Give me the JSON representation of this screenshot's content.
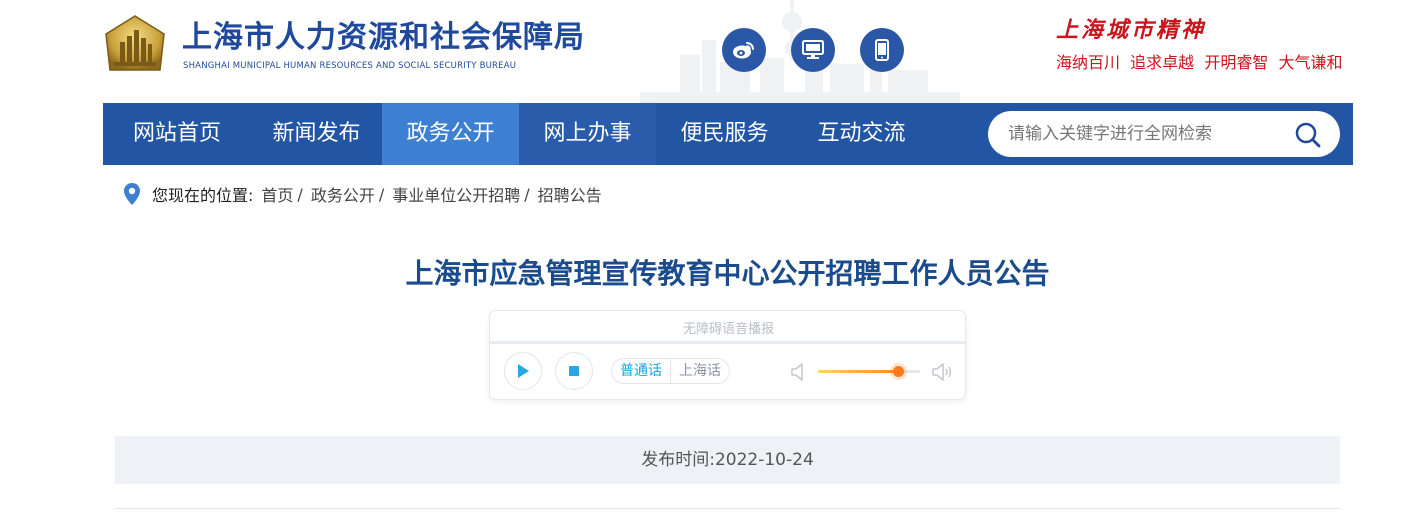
{
  "header": {
    "org_name_cn": "上海市人力资源和社会保障局",
    "org_name_en": "SHANGHAI MUNICIPAL HUMAN RESOURCES AND SOCIAL SECURITY BUREAU",
    "icons": [
      "logo-emblem",
      "weibo-icon",
      "computer-icon",
      "mobile-icon"
    ],
    "spirit_title": "上海城市精神",
    "spirit_slogan": "海纳百川  追求卓越  开明睿智  大气谦和"
  },
  "nav": {
    "items": [
      {
        "label": "网站首页",
        "active": false
      },
      {
        "label": "新闻发布",
        "active": false
      },
      {
        "label": "政务公开",
        "active": true
      },
      {
        "label": "网上办事",
        "active": false
      },
      {
        "label": "便民服务",
        "active": false
      },
      {
        "label": "互动交流",
        "active": false
      }
    ],
    "search_placeholder": "请输入关键字进行全网检索"
  },
  "breadcrumb": {
    "label": "您现在的位置:",
    "items": [
      "首页",
      "政务公开",
      "事业单位公开招聘",
      "招聘公告"
    ]
  },
  "article": {
    "title": "上海市应急管理宣传教育中心公开招聘工作人员公告",
    "publish_time": "发布时间:2022-10-24"
  },
  "player": {
    "label": "无障碍语音播报",
    "lang_options": [
      "普通话",
      "上海话"
    ],
    "selected_lang": "普通话",
    "volume": 0.78
  },
  "colors": {
    "nav_bg": "#2255a4",
    "nav_active": "#3d7fd1",
    "title": "#1a4b8c",
    "spirit_red": "#c8161d",
    "accent_blue": "#1aa3d9",
    "volume_orange": "#ff7a1a"
  }
}
